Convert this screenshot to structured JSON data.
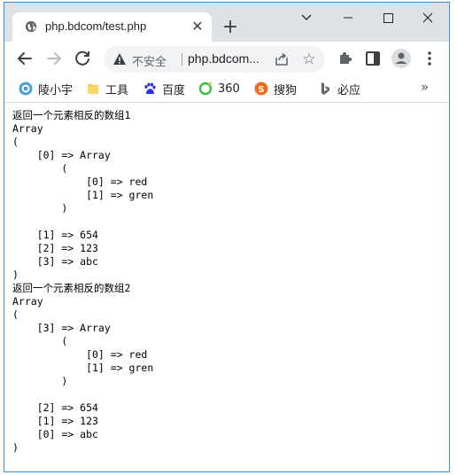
{
  "tab": {
    "title": "php.bdcom/test.php"
  },
  "toolbar": {
    "security_label": "不安全",
    "url": "php.bdcom..."
  },
  "bookmarks": [
    {
      "label": "陵小宇",
      "icon": "bookmark-site-icon",
      "color": "#4a9fd8"
    },
    {
      "label": "工具",
      "icon": "folder-icon",
      "color": "#f5c842"
    },
    {
      "label": "百度",
      "icon": "baidu-paw-icon",
      "color": "#2932e1"
    },
    {
      "label": "360",
      "icon": "360-icon",
      "color": "#3ebd3e"
    },
    {
      "label": "搜狗",
      "icon": "sogou-icon",
      "color": "#f26b1d"
    },
    {
      "label": "必应",
      "icon": "bing-icon",
      "color": "#666666"
    }
  ],
  "page": {
    "content": "返回一个元素相反的数组1\nArray\n(\n    [0] => Array\n        (\n            [0] => red\n            [1] => gren\n        )\n\n    [1] => 654\n    [2] => 123\n    [3] => abc\n)\n返回一个元素相反的数组2\nArray\n(\n    [3] => Array\n        (\n            [0] => red\n            [1] => gren\n        )\n\n    [2] => 654\n    [1] => 123\n    [0] => abc\n)"
  }
}
